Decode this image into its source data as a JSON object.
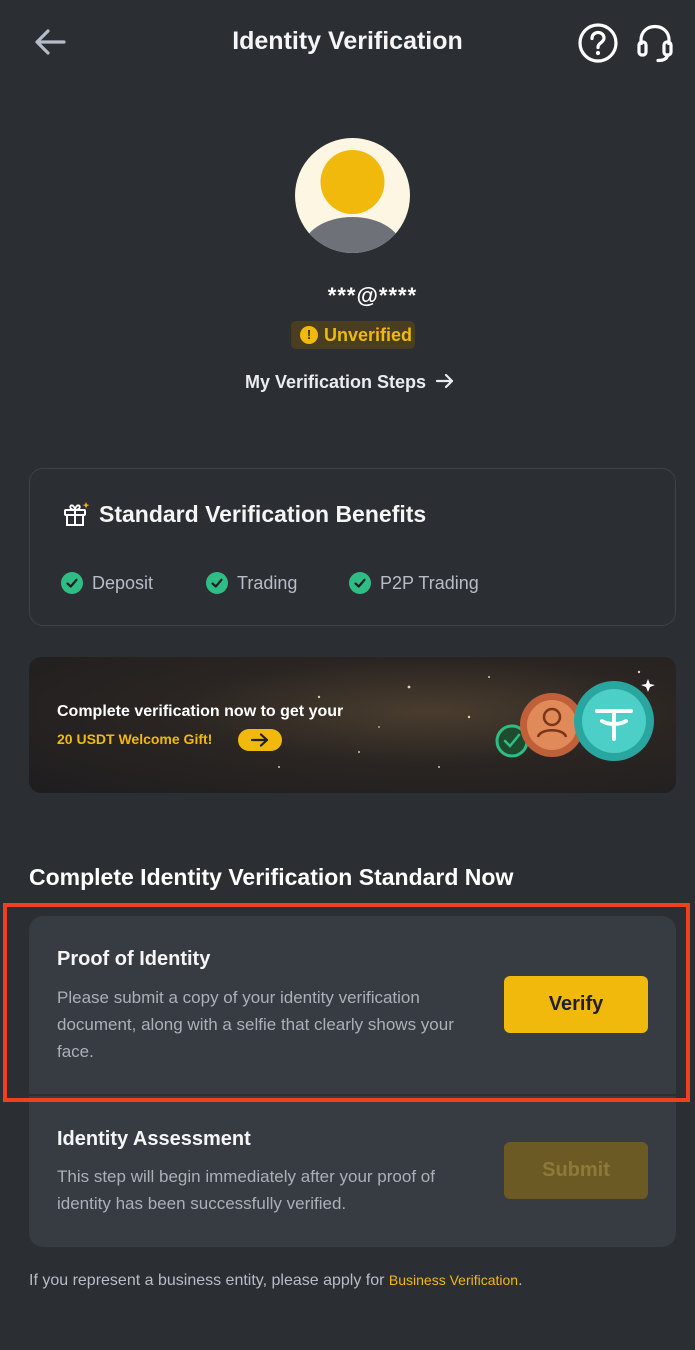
{
  "header": {
    "title": "Identity Verification",
    "back_icon": "arrow-left-icon",
    "help_icon": "question-circle-icon",
    "support_icon": "headset-icon"
  },
  "profile": {
    "account": "***@****",
    "status": "Unverified",
    "steps_link": "My Verification Steps"
  },
  "benefits": {
    "title": "Standard Verification Benefits",
    "items": [
      "Deposit",
      "Trading",
      "P2P Trading"
    ]
  },
  "promo": {
    "line1": "Complete verification now to get your",
    "line2": "20 USDT Welcome Gift!"
  },
  "section": {
    "heading": "Complete Identity Verification Standard Now"
  },
  "proof": {
    "title": "Proof of Identity",
    "desc": "Please submit a copy of your identity verification document, along with a selfie that clearly shows your face.",
    "button": "Verify"
  },
  "assessment": {
    "title": "Identity Assessment",
    "desc": "This step will begin immediately after your proof of identity has been successfully verified.",
    "button": "Submit"
  },
  "footer": {
    "text": "If you represent a business entity, please apply for ",
    "link": "Business Verification",
    "end": "."
  },
  "colors": {
    "accent": "#f0b90b",
    "success": "#2ebd85",
    "background": "#2b2e33",
    "highlight": "#f0411f"
  }
}
